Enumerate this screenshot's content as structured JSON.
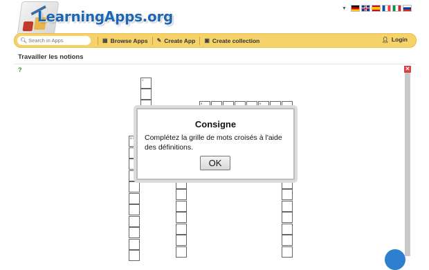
{
  "header": {
    "logo_text": "LearningApps.org",
    "languages": [
      "de",
      "en",
      "es",
      "fr",
      "it",
      "ru"
    ]
  },
  "navbar": {
    "search_placeholder": "Search in Apps",
    "browse_label": "Browse Apps",
    "create_app_label": "Create App",
    "create_collection_label": "Create collection",
    "login_label": "Login"
  },
  "page": {
    "title": "Travailler les notions"
  },
  "crossword": {
    "clue_numbers": [
      "1",
      "5",
      "6",
      "7",
      "8.3"
    ]
  },
  "modal": {
    "title": "Consigne",
    "text": "Complétez la grille de mots croisés à l'aide des définitions.",
    "ok_label": "OK"
  },
  "colors": {
    "navbar_bg": "#f6d36a",
    "logo_blue": "#1f67b3",
    "close_red": "#d94040"
  }
}
